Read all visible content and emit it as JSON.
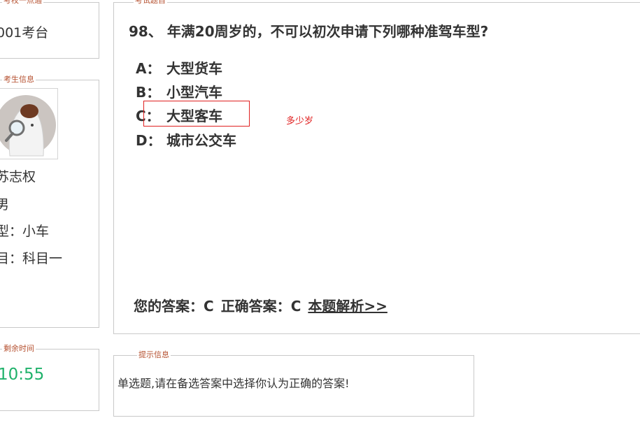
{
  "exam_point": {
    "legend": "考校一点通",
    "seat": "001考台"
  },
  "student_info": {
    "legend": "考生信息",
    "name": "苏志权",
    "gender": "男",
    "vehicle_type": "型：小车",
    "subject": "目：科目一"
  },
  "remaining_time": {
    "legend": "剩余时间",
    "time": "10:55"
  },
  "question": {
    "legend": "考试题目",
    "number": "98、",
    "text": "年满20周岁的，不可以初次申请下列哪种准驾车型?",
    "options": [
      {
        "letter": "A：",
        "text": "大型货车"
      },
      {
        "letter": "B：",
        "text": "小型汽车"
      },
      {
        "letter": "C：",
        "text": "大型客车"
      },
      {
        "letter": "D：",
        "text": "城市公交车"
      }
    ],
    "annotation": "多少岁",
    "your_answer_label": "您的答案：",
    "your_answer": "C",
    "correct_answer_label": "正确答案：",
    "correct_answer": "C",
    "analysis_link": "本题解析>>"
  },
  "tips": {
    "legend": "提示信息",
    "text": "单选题,请在备选答案中选择你认为正确的答案!"
  },
  "colors": {
    "legend": "#b5502f",
    "time": "#20b26b",
    "highlight": "#e02020",
    "border": "#c9c9c9"
  }
}
